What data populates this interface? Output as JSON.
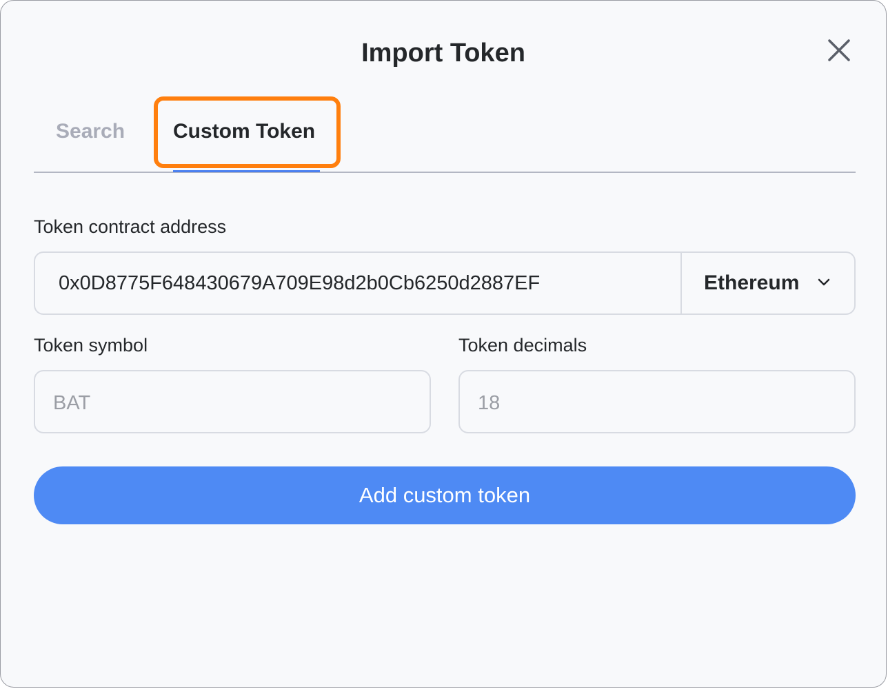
{
  "dialog": {
    "title": "Import Token",
    "close_icon": "close-icon"
  },
  "tabs": [
    {
      "label": "Search",
      "active": false
    },
    {
      "label": "Custom Token",
      "active": true
    }
  ],
  "form": {
    "address": {
      "label": "Token contract address",
      "value": "0x0D8775F648430679A709E98d2b0Cb6250d2887EF",
      "network": "Ethereum",
      "network_icon": "chevron-down-icon"
    },
    "symbol": {
      "label": "Token symbol",
      "value": "BAT"
    },
    "decimals": {
      "label": "Token decimals",
      "value": "18"
    }
  },
  "add_button_label": "Add custom token",
  "colors": {
    "highlight": "#ff7f0e",
    "accent": "#4e8af4",
    "tab_underline": "#4a7ff0",
    "text": "#24272a",
    "muted": "#a9acb8"
  }
}
